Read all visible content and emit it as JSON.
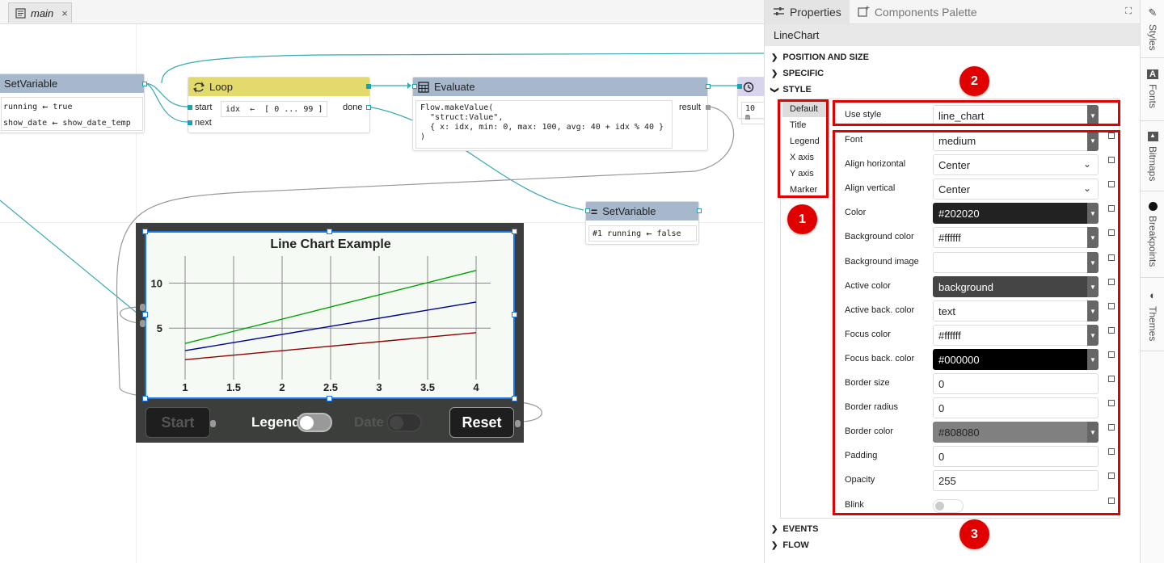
{
  "document_tab": {
    "label": "main",
    "icon": "document-icon",
    "close": "×"
  },
  "nodes": {
    "setvar1": {
      "title": "SetVariable",
      "rows": [
        {
          "left": "running",
          "arrow": "←",
          "right": "true"
        },
        {
          "left": "show_date",
          "arrow": "←",
          "right": "show_date_temp"
        }
      ]
    },
    "loop": {
      "title": "Loop",
      "inputs": [
        "start",
        "next"
      ],
      "expr": "idx  ←  [ 0 ... 99 ]",
      "output": "done"
    },
    "evaluate": {
      "title": "Evaluate",
      "code": "Flow.makeValue(\n  \"struct:Value\",\n  { x: idx, min: 0, max: 100, avg: 40 + idx % 40 }\n)",
      "output": "result"
    },
    "timer": {
      "expr": "10 m"
    },
    "setvar2": {
      "title": "SetVariable",
      "row": {
        "left": "#1 running",
        "arrow": "←",
        "right": "false"
      }
    }
  },
  "widget": {
    "start_label": "Start",
    "legend_label": "Legend",
    "date_label": "Date",
    "reset_label": "Reset"
  },
  "chart_data": {
    "type": "line",
    "title": "Line Chart Example",
    "x": [
      1,
      4
    ],
    "xticks": [
      "1",
      "1.5",
      "2",
      "2.5",
      "3",
      "3.5",
      "4"
    ],
    "yticks": [
      "5",
      "10"
    ],
    "xlim": [
      1,
      4
    ],
    "ylim": [
      0,
      13
    ],
    "grid": true,
    "series": [
      {
        "color": "#00a000",
        "values": [
          3.3,
          11.4
        ]
      },
      {
        "color": "#000090",
        "values": [
          2.5,
          7.9
        ]
      },
      {
        "color": "#900000",
        "values": [
          1.5,
          4.5
        ]
      }
    ]
  },
  "panel": {
    "tab_properties": "Properties",
    "tab_palette": "Components Palette",
    "component_title": "LineChart",
    "sections": {
      "position": "POSITION AND SIZE",
      "specific": "SPECIFIC",
      "style": "STYLE",
      "events": "EVENTS",
      "flow": "FLOW"
    },
    "style_items": [
      "Default",
      "Title",
      "Legend",
      "X axis",
      "Y axis",
      "Marker"
    ],
    "use_style": {
      "label": "Use style",
      "value": "line_chart"
    },
    "props": [
      {
        "label": "Font",
        "value": "medium",
        "kind": "dd"
      },
      {
        "label": "Align horizontal",
        "value": "Center",
        "kind": "select"
      },
      {
        "label": "Align vertical",
        "value": "Center",
        "kind": "select"
      },
      {
        "label": "Color",
        "value": "#202020",
        "kind": "dd",
        "swatch": "dark"
      },
      {
        "label": "Background color",
        "value": "#ffffff",
        "kind": "dd"
      },
      {
        "label": "Background image",
        "value": "",
        "kind": "dd"
      },
      {
        "label": "Active color",
        "value": "background",
        "kind": "dd",
        "swatch": "medgray"
      },
      {
        "label": "Active back. color",
        "value": "text",
        "kind": "dd"
      },
      {
        "label": "Focus color",
        "value": "#ffffff",
        "kind": "dd"
      },
      {
        "label": "Focus back. color",
        "value": "#000000",
        "kind": "dd",
        "swatch": "black"
      },
      {
        "label": "Border size",
        "value": "0",
        "kind": "text"
      },
      {
        "label": "Border radius",
        "value": "0",
        "kind": "text"
      },
      {
        "label": "Border color",
        "value": "#808080",
        "kind": "dd",
        "swatch": "gray"
      },
      {
        "label": "Padding",
        "value": "0",
        "kind": "text"
      },
      {
        "label": "Opacity",
        "value": "255",
        "kind": "text"
      },
      {
        "label": "Blink",
        "value": "",
        "kind": "switch"
      }
    ]
  },
  "annotations": [
    "1",
    "2",
    "3"
  ],
  "side_tabs": [
    "Styles",
    "Fonts",
    "Bitmaps",
    "Breakpoints",
    "Themes"
  ]
}
